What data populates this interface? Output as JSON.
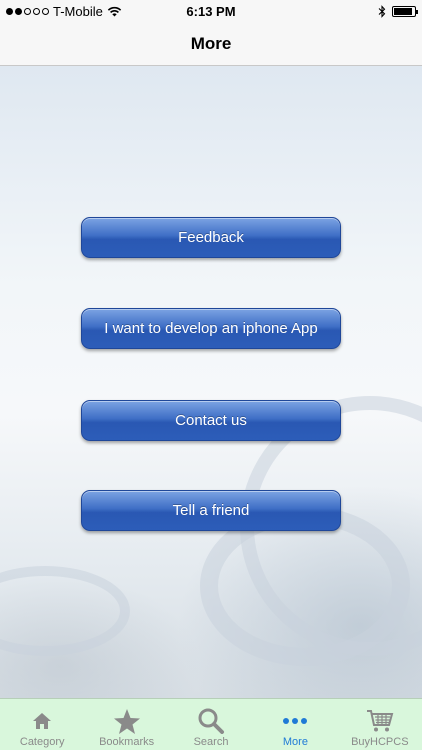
{
  "status_bar": {
    "carrier": "T-Mobile",
    "time": "6:13 PM"
  },
  "nav": {
    "title": "More"
  },
  "menu": {
    "buttons": [
      {
        "label": "Feedback"
      },
      {
        "label": "I want to develop an iphone App"
      },
      {
        "label": "Contact us"
      },
      {
        "label": "Tell a friend"
      }
    ]
  },
  "tab_bar": {
    "tabs": [
      {
        "label": "Category",
        "icon": "home-icon"
      },
      {
        "label": "Bookmarks",
        "icon": "star-icon"
      },
      {
        "label": "Search",
        "icon": "search-icon"
      },
      {
        "label": "More",
        "icon": "more-icon",
        "active": true
      },
      {
        "label": "BuyHCPCS",
        "icon": "cart-icon"
      }
    ],
    "colors": {
      "background": "#d9f7dc",
      "active": "#1f7ad6",
      "inactive": "#8a8a8a"
    }
  },
  "colors": {
    "button_top": "#7ca3e3",
    "button_bottom": "#2c5db9"
  }
}
